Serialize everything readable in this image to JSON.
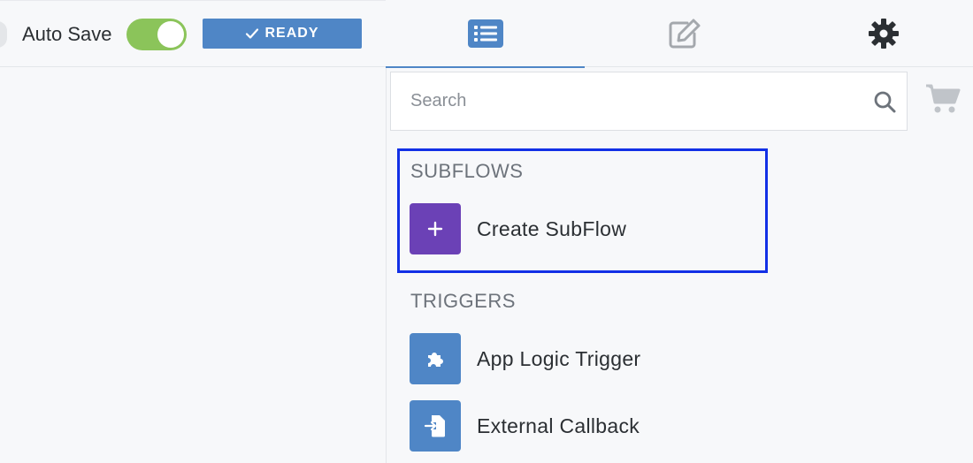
{
  "toolbar": {
    "autosave_label": "Auto Save",
    "autosave_on": true,
    "status_label": "READY",
    "colors": {
      "toggle_on": "#8bc45a",
      "status_badge": "#4f86c6",
      "accent": "#4f86c6"
    }
  },
  "tabs": [
    {
      "icon": "list-icon",
      "active": true
    },
    {
      "icon": "edit-icon",
      "active": false
    },
    {
      "icon": "gear-icon",
      "active": false
    }
  ],
  "search": {
    "placeholder": "Search",
    "value": ""
  },
  "sections": {
    "subflows": {
      "title": "SUBFLOWS",
      "items": [
        {
          "label": "Create SubFlow",
          "icon": "plus-icon",
          "color": "#6b41b6"
        }
      ]
    },
    "triggers": {
      "title": "TRIGGERS",
      "items": [
        {
          "label": "App Logic Trigger",
          "icon": "puzzle-icon",
          "color": "#4f86c6"
        },
        {
          "label": "External Callback",
          "icon": "file-import-icon",
          "color": "#4f86c6"
        }
      ]
    }
  },
  "highlight_color": "#1230e6"
}
